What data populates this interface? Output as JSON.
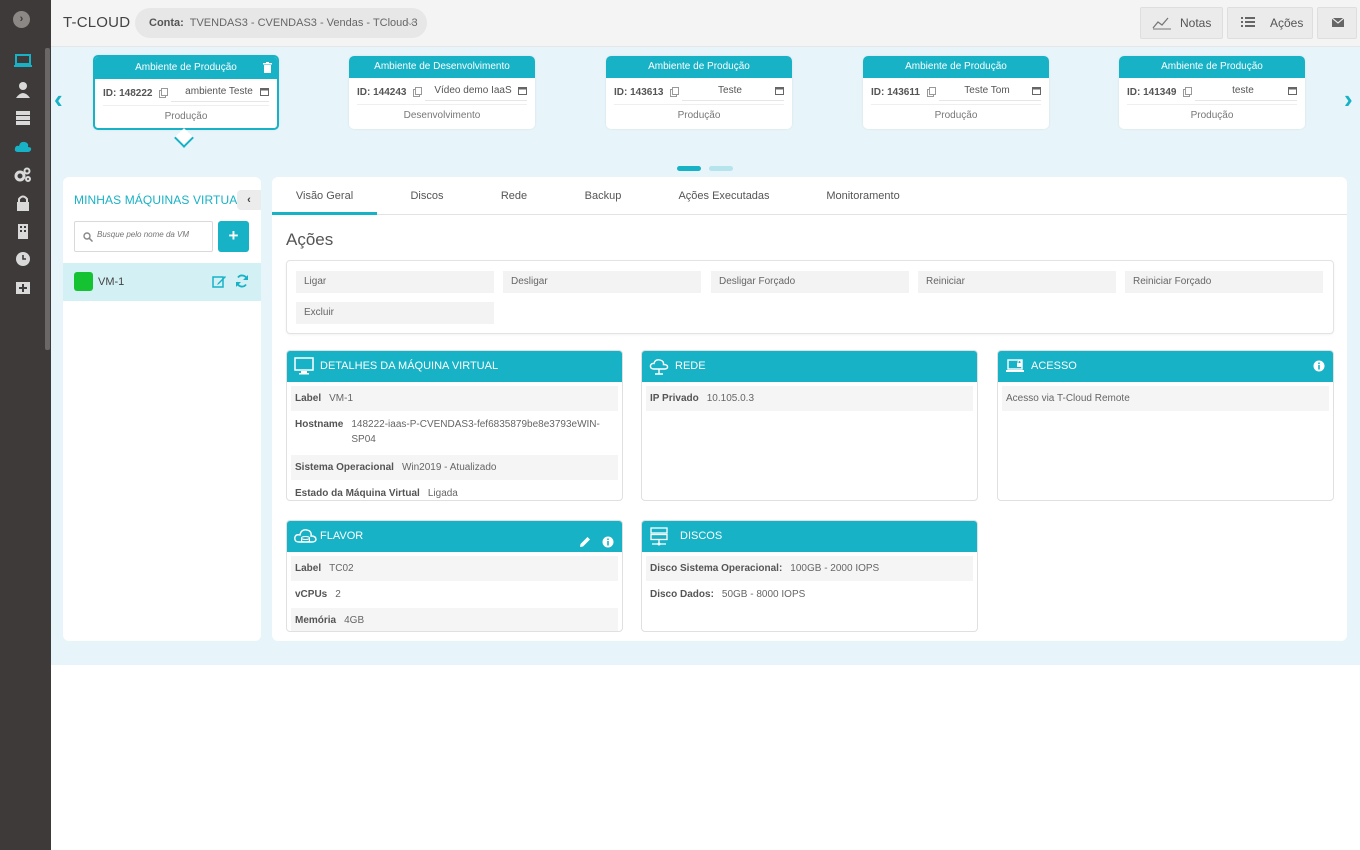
{
  "header": {
    "brand": "T-CLOUD",
    "account_label": "Conta:",
    "account_value": "TVENDAS3 - CVENDAS3 - Vendas - TCloud 3",
    "notes_label": "Notas",
    "actions_label": "Ações"
  },
  "environments": [
    {
      "header": "Ambiente de Produção",
      "id": "ID: 148222",
      "name": "ambiente Teste",
      "type": "Produção"
    },
    {
      "header": "Ambiente de Desenvolvimento",
      "id": "ID: 144243",
      "name": "Vídeo demo IaaS",
      "type": "Desenvolvimento"
    },
    {
      "header": "Ambiente de Produção",
      "id": "ID: 143613",
      "name": "Teste",
      "type": "Produção"
    },
    {
      "header": "Ambiente de Produção",
      "id": "ID: 143611",
      "name": "Teste Tom",
      "type": "Produção"
    },
    {
      "header": "Ambiente de Produção",
      "id": "ID: 141349",
      "name": "teste",
      "type": "Produção"
    }
  ],
  "sidebar": {
    "title": "MINHAS MÁQUINAS VIRTUAIS",
    "search_placeholder": "Busque pelo nome da VM",
    "add_label": "+",
    "vms": [
      {
        "name": "VM-1",
        "status_color": "#15c231"
      }
    ]
  },
  "tabs": [
    "Visão Geral",
    "Discos",
    "Rede",
    "Backup",
    "Ações Executadas",
    "Monitoramento"
  ],
  "actions": {
    "title": "Ações",
    "buttons": [
      "Ligar",
      "Desligar",
      "Desligar Forçado",
      "Reiniciar",
      "Reiniciar Forçado",
      "Excluir"
    ]
  },
  "vm_details": {
    "title": "DETALHES DA MÁQUINA VIRTUAL",
    "rows": [
      {
        "label": "Label",
        "value": "VM-1"
      },
      {
        "label": "Hostname",
        "value": "148222-iaas-P-CVENDAS3-fef6835879be8e3793eWIN-SP04"
      },
      {
        "label": "Sistema Operacional",
        "value": "Win2019 - Atualizado"
      },
      {
        "label": "Estado da Máquina Virtual",
        "value": "Ligada"
      }
    ]
  },
  "network": {
    "title": "REDE",
    "rows": [
      {
        "label": "IP Privado",
        "value": "10.105.0.3"
      }
    ]
  },
  "access": {
    "title": "ACESSO",
    "text": "Acesso via T-Cloud Remote"
  },
  "flavor": {
    "title": "FLAVOR",
    "rows": [
      {
        "label": "Label",
        "value": "TC02"
      },
      {
        "label": "vCPUs",
        "value": "2"
      },
      {
        "label": "Memória",
        "value": "4GB"
      }
    ]
  },
  "disks": {
    "title": "DISCOS",
    "rows": [
      {
        "label": "Disco Sistema Operacional:",
        "value": "100GB - 2000 IOPS"
      },
      {
        "label": "Disco Dados:",
        "value": "50GB - 8000 IOPS"
      }
    ]
  },
  "colors": {
    "accent": "#17b2c6",
    "sidebar_bg": "#3e3a39",
    "page_bg": "#e7f4fa",
    "status_on": "#15c231"
  }
}
